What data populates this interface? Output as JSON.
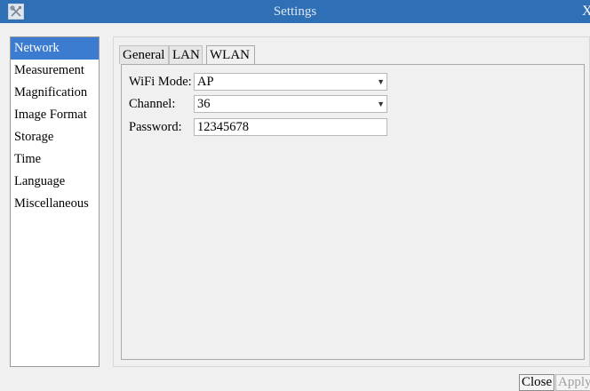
{
  "window": {
    "title": "Settings",
    "app_icon": "tools-icon",
    "close_glyph": "X"
  },
  "sidebar": {
    "items": [
      {
        "label": "Network",
        "selected": true
      },
      {
        "label": "Measurement",
        "selected": false
      },
      {
        "label": "Magnification",
        "selected": false
      },
      {
        "label": "Image Format",
        "selected": false
      },
      {
        "label": "Storage",
        "selected": false
      },
      {
        "label": "Time",
        "selected": false
      },
      {
        "label": "Language",
        "selected": false
      },
      {
        "label": "Miscellaneous",
        "selected": false
      }
    ]
  },
  "tabs": [
    {
      "label": "General",
      "active": false
    },
    {
      "label": "LAN",
      "active": false
    },
    {
      "label": "WLAN",
      "active": true
    }
  ],
  "wlan": {
    "wifi_mode": {
      "label": "WiFi Mode:",
      "value": "AP"
    },
    "channel": {
      "label": "Channel:",
      "value": "36"
    },
    "password": {
      "label": "Password:",
      "value": "12345678"
    }
  },
  "buttons": {
    "close": "Close",
    "apply": "Apply"
  },
  "colors": {
    "titlebar": "#2f6fb5",
    "selection": "#3b7bd0"
  }
}
